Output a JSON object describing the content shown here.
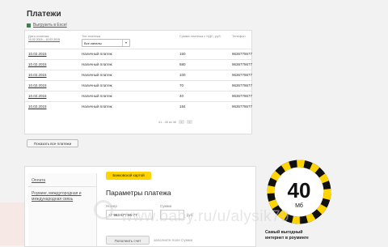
{
  "page": {
    "title": "Платежи"
  },
  "excel": {
    "label": "Выгрузить в Excel"
  },
  "table": {
    "headers": {
      "date": "Дата платежа",
      "type": "Тип платежа",
      "sum": "Сумма платежа с НДС, руб.",
      "phone": "Телефон"
    },
    "period": "10.02.2015 – 10.02.2015",
    "type_filter": "Все каналы",
    "rows": [
      {
        "date": "10.02.2015",
        "type": "Наличный платеж",
        "sum": "150",
        "phone": "9636778677"
      },
      {
        "date": "10.02.2015",
        "type": "Наличный платеж",
        "sum": "680",
        "phone": "9636778677"
      },
      {
        "date": "10.02.2015",
        "type": "Наличный платеж",
        "sum": "100",
        "phone": "9636778677"
      },
      {
        "date": "10.02.2015",
        "type": "Наличный платеж",
        "sum": "70",
        "phone": "9636778677"
      },
      {
        "date": "10.02.2015",
        "type": "Наличный платеж",
        "sum": "40",
        "phone": "9636778677"
      },
      {
        "date": "10.02.2015",
        "type": "Наличный платеж",
        "sum": "184",
        "phone": "9636778677"
      }
    ],
    "pager": "41 - 46 из 46",
    "prev": "‹",
    "next": "›"
  },
  "show_all": "Показать все платежи",
  "payment": {
    "side_items": [
      "Оплата",
      "Роуминг, междугородная и международная связь"
    ],
    "badge": "Банковской картой",
    "title": "Параметры платежа",
    "number_label": "Номер",
    "number_value": "+7 963 677-86-77",
    "sum_label": "Сумма",
    "sum_unit": "руб.",
    "pay_button": "Пополнить счет",
    "fill_label": "заполните поле Сумма"
  },
  "ad": {
    "value": "40",
    "unit": "Мб",
    "caption_line1": "Самый выгодный",
    "caption_line2": "интернет в роуминге",
    "ring_color": "#ffd400",
    "ring_dark": "#111111"
  },
  "watermark": "www.baby.ru/u/alysik79"
}
